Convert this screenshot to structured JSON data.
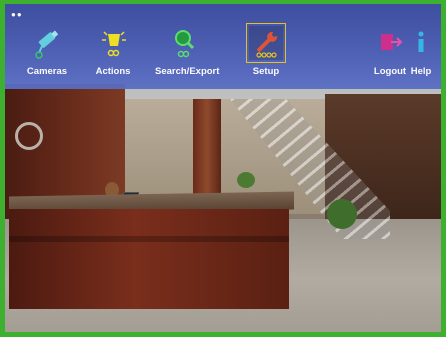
{
  "toolbar": {
    "items": [
      {
        "label": "Cameras",
        "icon": "camera-icon"
      },
      {
        "label": "Actions",
        "icon": "actions-bulb-icon"
      },
      {
        "label": "Search/Export",
        "icon": "search-magnifier-icon"
      },
      {
        "label": "Setup",
        "icon": "wrench-setup-icon",
        "selected": true
      },
      {
        "label": "Logout",
        "icon": "logout-door-icon"
      },
      {
        "label": "Help",
        "icon": "help-info-icon"
      }
    ]
  },
  "colors": {
    "frame_border": "#3db12f",
    "toolbar": "#4a5cb4",
    "selected_outline": "#e8c21a",
    "label_text": "#ffffff"
  }
}
